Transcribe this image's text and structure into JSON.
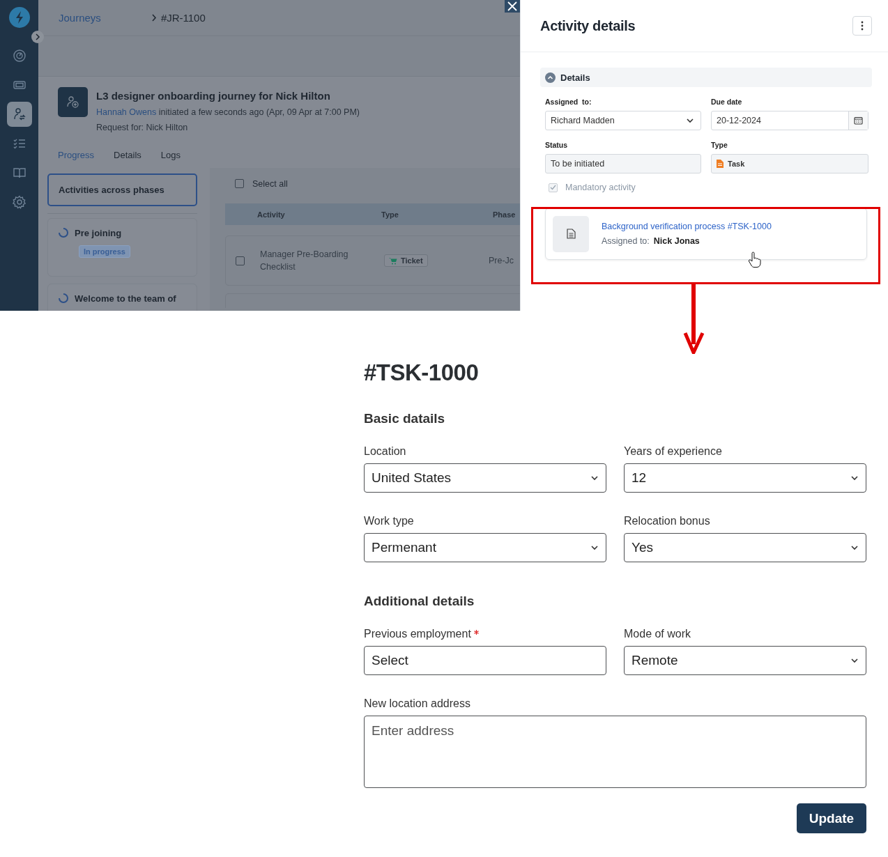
{
  "background_app": {
    "sidebar": {
      "items": [
        {
          "kind": "gauge",
          "selected": false
        },
        {
          "kind": "ticket",
          "selected": false
        },
        {
          "kind": "journey",
          "selected": true
        },
        {
          "kind": "checklist",
          "selected": false
        },
        {
          "kind": "book",
          "selected": false
        },
        {
          "kind": "gear",
          "selected": false
        }
      ]
    },
    "breadcrumb": [
      "Journeys",
      "#JR-1100"
    ],
    "journey": {
      "title": "L3 designer onboarding journey for Nick Hilton",
      "initiator": "Hannah Owens",
      "initiated_text": "initiated a few seconds ago (Apr, 09 Apr at 7:00 PM)",
      "request_for": "Request for: Nick Hilton"
    },
    "tabs": [
      {
        "label": "Progress",
        "selected": true
      },
      {
        "label": "Details",
        "selected": false
      },
      {
        "label": "Logs",
        "selected": false
      }
    ],
    "phases_header": "Activities across phases",
    "phases": [
      {
        "name": "Pre joining",
        "status": "In progress"
      },
      {
        "name": "Welcome to the team of"
      }
    ],
    "select_all": {
      "label": "Select all",
      "checked": false
    },
    "table": {
      "columns": [
        "Activity",
        "Type",
        "Phase"
      ],
      "rows": [
        {
          "checked": false,
          "activity": "Manager Pre-Boarding Checklist",
          "type": "Ticket",
          "phase": "Pre-Jc"
        }
      ]
    }
  },
  "activity_panel": {
    "title": "Activity details",
    "section": {
      "title": "Details",
      "expanded": true
    },
    "fields": [
      {
        "kind": "dropdown",
        "label": "Assigned  to:",
        "value": "Richard Madden"
      },
      {
        "kind": "date",
        "label": "Due date",
        "value": "20-12-2024"
      },
      {
        "kind": "readonly",
        "label": "Status",
        "value": "To be initiated"
      },
      {
        "kind": "type",
        "label": "Type",
        "value": "Task"
      }
    ],
    "mandatory": {
      "label": "Mandatory activity",
      "checked": true
    },
    "linked_task": {
      "title": "Background verification process #TSK-1000",
      "assigned_label": "Assigned to:",
      "assignee": "Nick Jonas"
    }
  },
  "task_form": {
    "title": "#TSK-1000",
    "sections": [
      {
        "title": "Basic datails",
        "fields": [
          {
            "kind": "dropdown",
            "label": "Location",
            "value": "United States",
            "required": false
          },
          {
            "kind": "dropdown",
            "label": "Years of experience",
            "value": "12",
            "required": false
          },
          {
            "kind": "dropdown",
            "label": "Work type",
            "value": "Permenant",
            "required": false
          },
          {
            "kind": "dropdown",
            "label": "Relocation bonus",
            "value": "Yes",
            "required": false
          }
        ]
      },
      {
        "title": "Additional details",
        "fields": [
          {
            "kind": "input",
            "label": "Previous employment",
            "value": "Select",
            "required": true
          },
          {
            "kind": "dropdown",
            "label": "Mode of work",
            "value": "Remote",
            "required": false
          },
          {
            "kind": "textarea",
            "label": "New location address",
            "placeholder": "Enter address",
            "required": false
          }
        ]
      }
    ],
    "button": "Update"
  }
}
